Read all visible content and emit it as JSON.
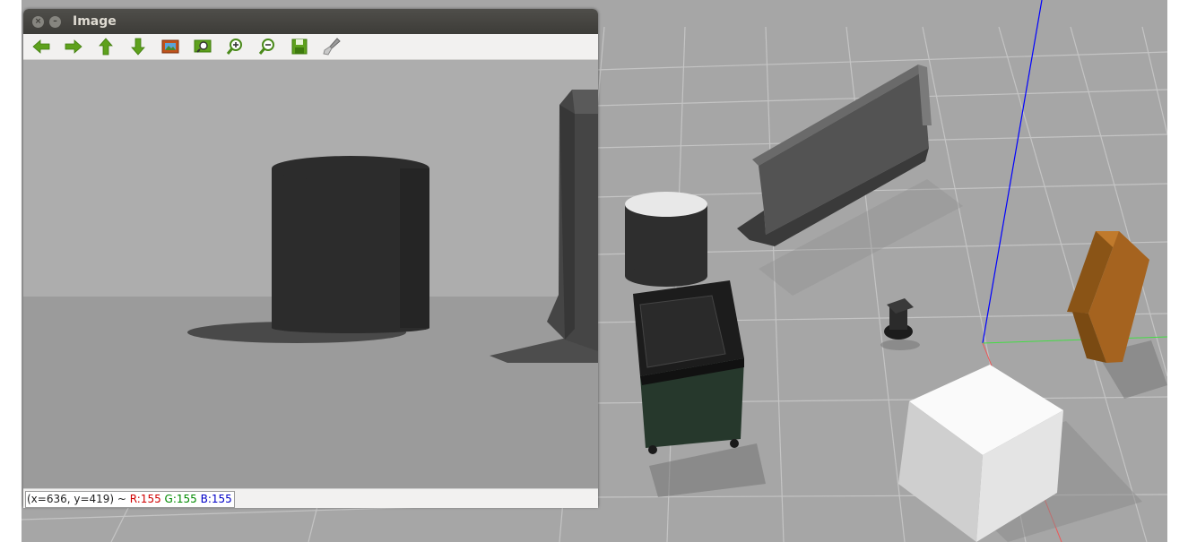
{
  "window": {
    "title": "Image",
    "close_glyph": "×",
    "minimize_glyph": "–"
  },
  "toolbar": {
    "buttons": [
      {
        "name": "back-arrow-icon",
        "tooltip": "Back"
      },
      {
        "name": "forward-arrow-icon",
        "tooltip": "Forward"
      },
      {
        "name": "up-arrow-icon",
        "tooltip": "Pan"
      },
      {
        "name": "down-arrow-icon",
        "tooltip": "Down"
      },
      {
        "name": "image-icon",
        "tooltip": "Image"
      },
      {
        "name": "zoom-to-fit-icon",
        "tooltip": "Zoom to fit"
      },
      {
        "name": "zoom-in-icon",
        "tooltip": "Zoom in"
      },
      {
        "name": "zoom-out-icon",
        "tooltip": "Zoom out"
      },
      {
        "name": "save-icon",
        "tooltip": "Save"
      },
      {
        "name": "brush-icon",
        "tooltip": "Clear"
      }
    ]
  },
  "status": {
    "coords": "(x=636, y=419) ~ ",
    "r": "R:155",
    "g": "G:155",
    "b": "B:155",
    "colors": {
      "r": "#d00000",
      "g": "#008a00",
      "b": "#0000c8"
    }
  },
  "scene": {
    "ground_color": "#a3a3a3",
    "grid_color": "#c7c7c7",
    "axis_colors": {
      "z": "#0000ff",
      "x": "#ff2222",
      "y": "#22cc22"
    }
  }
}
